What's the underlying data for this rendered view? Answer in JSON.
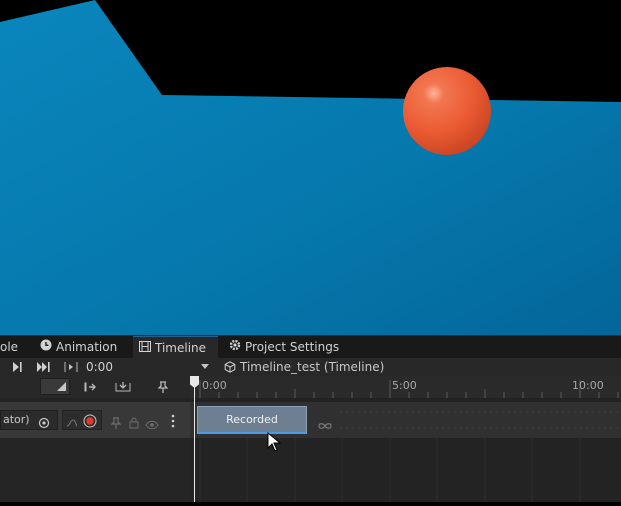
{
  "tabs": [
    {
      "label": "ole",
      "icon": "console-icon"
    },
    {
      "label": "Animation",
      "icon": "clock-icon"
    },
    {
      "label": "Timeline",
      "icon": "film-strip-icon"
    },
    {
      "label": "Project Settings",
      "icon": "gear-icon"
    }
  ],
  "toolbar": {
    "time": "0:00",
    "asset_title": "Timeline_test (Timeline)"
  },
  "ruler": {
    "ticks": [
      "0:00",
      "5:00",
      "10:00"
    ]
  },
  "track": {
    "binding_label": "ator)",
    "clip_label": "Recorded"
  },
  "colors": {
    "scene_sky": "#000000",
    "scene_ground": "#0a78aa",
    "sphere": "#f0623a",
    "accent": "#4d9be6"
  }
}
